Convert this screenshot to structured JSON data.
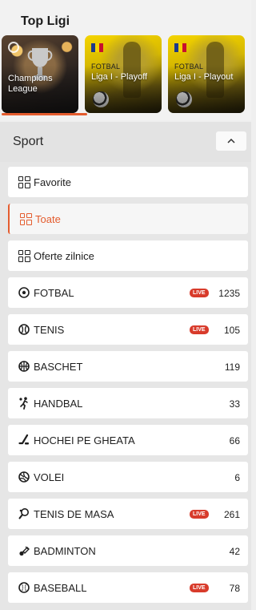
{
  "top_ligi": {
    "title": "Top Ligi",
    "cards": [
      {
        "label": "Champions League",
        "line1": "Champions",
        "line2": "League"
      },
      {
        "sub": "FOTBAL",
        "label": "Liga I - Playoff"
      },
      {
        "sub": "FOTBAL",
        "label": "Liga I - Playout"
      }
    ]
  },
  "sport": {
    "title": "Sport",
    "items": [
      {
        "label": "Favorite",
        "icon": "grid-icon"
      },
      {
        "label": "Toate",
        "icon": "grid-icon",
        "active": true
      },
      {
        "label": "Oferte zilnice",
        "icon": "grid-icon"
      },
      {
        "label": "FOTBAL",
        "icon": "soccer-ball-icon",
        "live": "LIVE",
        "count": "1235"
      },
      {
        "label": "TENIS",
        "icon": "tennis-ball-icon",
        "live": "LIVE",
        "count": "105"
      },
      {
        "label": "BASCHET",
        "icon": "basketball-icon",
        "count": "119"
      },
      {
        "label": "HANDBAL",
        "icon": "handball-icon",
        "count": "33"
      },
      {
        "label": "HOCHEI PE GHEATA",
        "icon": "hockey-stick-icon",
        "count": "66"
      },
      {
        "label": "VOLEI",
        "icon": "volleyball-icon",
        "count": "6"
      },
      {
        "label": "TENIS DE MASA",
        "icon": "table-tennis-icon",
        "live": "LIVE",
        "count": "261"
      },
      {
        "label": "BADMINTON",
        "icon": "shuttlecock-icon",
        "count": "42"
      },
      {
        "label": "BASEBALL",
        "icon": "baseball-icon",
        "live": "LIVE",
        "count": "78"
      }
    ]
  },
  "colors": {
    "accent": "#e45c2e",
    "live_badge": "#d83b2b"
  }
}
